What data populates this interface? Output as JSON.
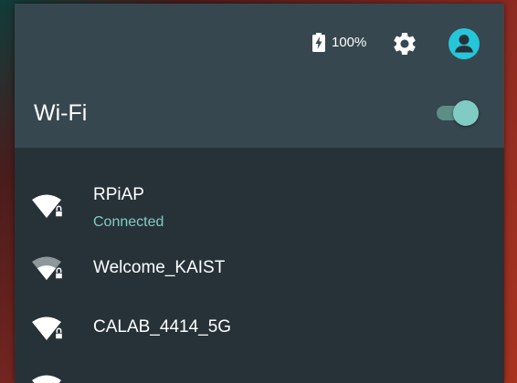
{
  "status_bar": {
    "battery_icon": "battery-charging-icon",
    "battery_level": "100%",
    "settings_icon": "gear-icon",
    "account_icon": "account-circle-icon"
  },
  "wifi": {
    "title": "Wi-Fi",
    "enabled": true
  },
  "networks": [
    {
      "name": "RPiAP",
      "status": "Connected",
      "icon": "wifi-lock-icon"
    },
    {
      "name": "Welcome_KAIST",
      "status": "",
      "icon": "wifi-lock-icon"
    },
    {
      "name": "CALAB_4414_5G",
      "status": "",
      "icon": "wifi-lock-icon"
    },
    {
      "name": "",
      "status": "",
      "icon": "wifi-lock-icon"
    }
  ],
  "colors": {
    "header_bg": "#37474f",
    "list_bg": "#263238",
    "accent": "#80cbc4",
    "text": "#ffffff"
  }
}
